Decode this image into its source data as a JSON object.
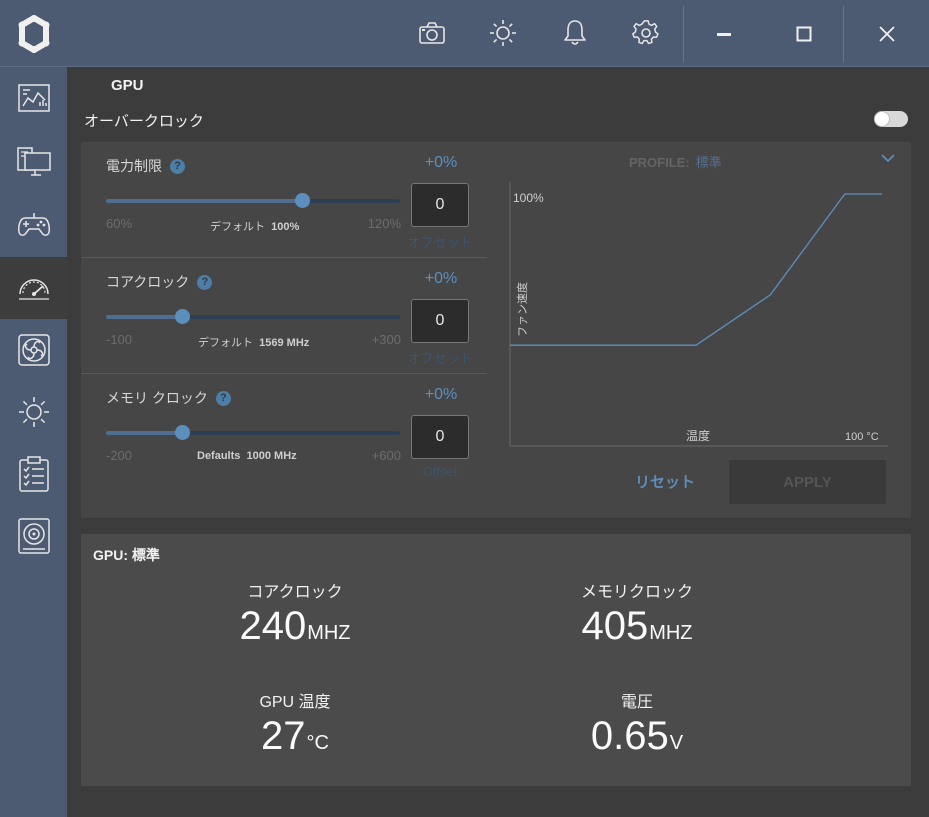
{
  "icons": {
    "logo": "app-logo-icon",
    "toolbar": [
      "camera-icon",
      "brightness-icon",
      "bell-icon",
      "gear-icon"
    ],
    "window": [
      "minimize-icon",
      "maximize-icon",
      "close-icon"
    ],
    "sidebar": [
      "dashboard-icon",
      "monitor-icon",
      "gamepad-icon",
      "gauge-icon",
      "fan-icon",
      "lighting-icon",
      "clipboard-icon",
      "storage-icon"
    ],
    "active_sidebar": "gauge-icon"
  },
  "colors": {
    "accent": "#5d8fbd",
    "sidebar": "#4c5a72",
    "panel": "#464646",
    "stats_panel": "#4b4b4b"
  },
  "main": {
    "title": "GPU",
    "overclock_label": "オーバークロック",
    "overclock_enabled": false
  },
  "sliders": [
    {
      "label": "電力制限",
      "help": "?",
      "percent": "+0%",
      "min": "60%",
      "max": "120%",
      "default_label": "デフォルト",
      "default_value": "100%",
      "position": 0.67,
      "offset_value": "0",
      "offset_label": "オフセット"
    },
    {
      "label": "コアクロック",
      "help": "?",
      "percent": "+0%",
      "min": "-100",
      "max": "+300",
      "default_label": "デフォルト",
      "default_value": "1569 MHz",
      "position": 0.26,
      "offset_value": "0",
      "offset_label": "オフセット"
    },
    {
      "label": "メモリ クロック",
      "help": "?",
      "percent": "+0%",
      "min": "-200",
      "max": "+600",
      "default_label": "Defaults",
      "default_value": "1000 MHz",
      "position": 0.26,
      "offset_value": "0",
      "offset_label": "Offset"
    }
  ],
  "fan": {
    "profile_label": "PROFILE:",
    "profile_value": "標準",
    "y_max_label": "100%",
    "y_label": "ファン速度",
    "x_label": "温度",
    "x_max_label": "100 °C",
    "reset_label": "リセット",
    "apply_label": "APPLY"
  },
  "chart_data": {
    "type": "line",
    "title": "",
    "xlabel": "温度",
    "ylabel": "ファン速度",
    "xlim": [
      0,
      100
    ],
    "ylim": [
      0,
      100
    ],
    "grid": false,
    "series": [
      {
        "x": [
          0,
          50,
          70,
          90,
          100
        ],
        "y": [
          40,
          40,
          60,
          100,
          100
        ]
      }
    ]
  },
  "stats": {
    "title": "GPU: 標準",
    "items": [
      {
        "label": "コアクロック",
        "value": "240",
        "unit": "MHZ"
      },
      {
        "label": "メモリクロック",
        "value": "405",
        "unit": "MHZ"
      },
      {
        "label": "GPU 温度",
        "value": "27",
        "unit": "°C"
      },
      {
        "label": "電圧",
        "value": "0.65",
        "unit": "V"
      }
    ]
  }
}
